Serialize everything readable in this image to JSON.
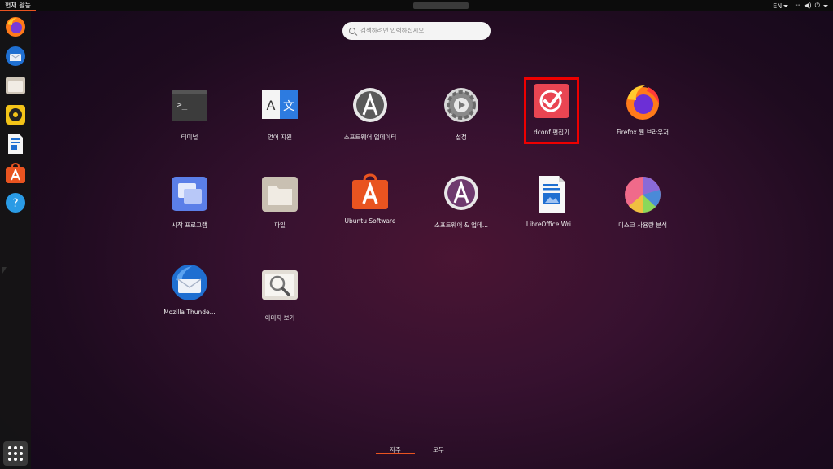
{
  "topbar": {
    "activities": "현재 활동",
    "lang": "EN"
  },
  "search": {
    "placeholder": "검색하려면 입력하십시오"
  },
  "apps": [
    {
      "label": "터미널",
      "icon": "terminal-icon"
    },
    {
      "label": "언어 지원",
      "icon": "language-support-icon"
    },
    {
      "label": "소프트웨어 업데이터",
      "icon": "software-updater-icon"
    },
    {
      "label": "설정",
      "icon": "settings-icon"
    },
    {
      "label": "dconf 편집기",
      "icon": "dconf-editor-icon"
    },
    {
      "label": "Firefox 웹 브라우저",
      "icon": "firefox-icon"
    },
    {
      "label": "시작 프로그램",
      "icon": "startup-apps-icon"
    },
    {
      "label": "파일",
      "icon": "files-icon"
    },
    {
      "label": "Ubuntu Software",
      "icon": "ubuntu-software-icon"
    },
    {
      "label": "소프트웨어 & 업데...",
      "icon": "software-updates-icon"
    },
    {
      "label": "LibreOffice Wri...",
      "icon": "libreoffice-writer-icon"
    },
    {
      "label": "디스크 사용량 분석",
      "icon": "disk-usage-icon"
    },
    {
      "label": "Mozilla Thunde...",
      "icon": "thunderbird-icon"
    },
    {
      "label": "이미지 보기",
      "icon": "image-viewer-icon"
    }
  ],
  "tabs": {
    "frequent": "자주",
    "all": "모두"
  },
  "colors": {
    "accent": "#e95420",
    "selection": "#ee0000"
  }
}
